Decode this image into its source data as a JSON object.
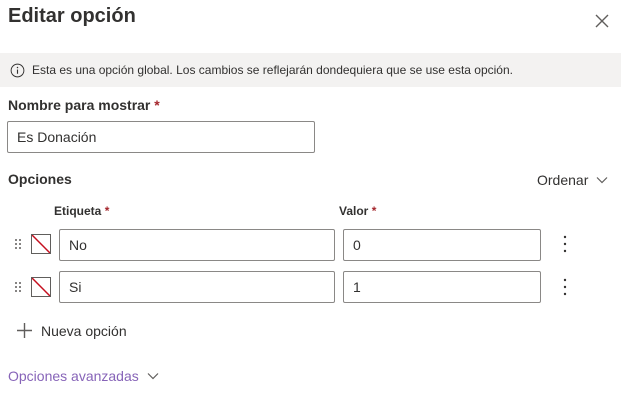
{
  "panel": {
    "title": "Editar opción",
    "banner_text": "Esta es una opción global. Los cambios se reflejarán dondequiera que se use esta opción."
  },
  "display_name": {
    "label": "Nombre para mostrar",
    "required_mark": "*",
    "value": "Es Donación"
  },
  "options": {
    "label": "Opciones",
    "sort_label": "Ordenar",
    "column_label": "Etiqueta",
    "column_value": "Valor",
    "required_mark": "*",
    "rows": [
      {
        "label": "No",
        "value": "0"
      },
      {
        "label": "Si",
        "value": "1"
      }
    ],
    "add_label": "Nueva opción"
  },
  "advanced": {
    "label": "Opciones avanzadas"
  },
  "icons": {
    "close": "close-icon",
    "info": "info-icon",
    "drag": "drag-handle-icon",
    "no_color": "no-color-icon",
    "more": "more-vertical-icon",
    "add": "plus-icon",
    "chevron": "chevron-down-icon"
  },
  "colors": {
    "accent": "#8764b8",
    "required": "#a4262c",
    "no_color_slash": "#c50f1f",
    "banner_bg": "#f3f2f1"
  }
}
